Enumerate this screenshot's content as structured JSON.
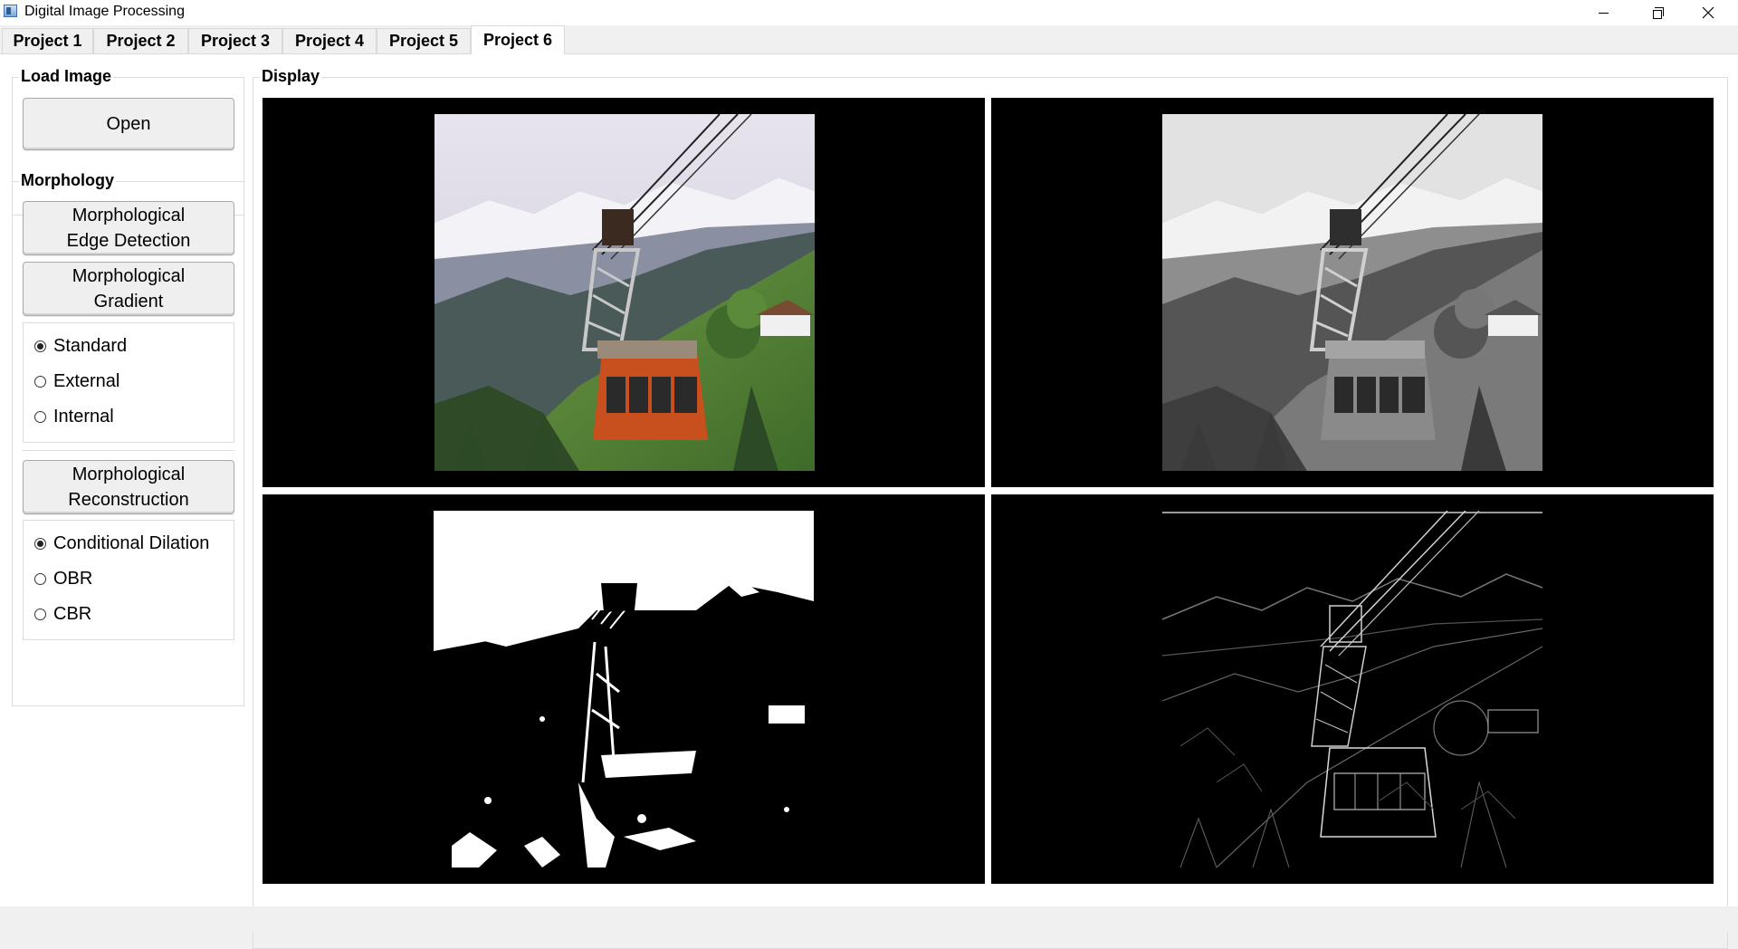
{
  "window": {
    "title": "Digital Image Processing"
  },
  "tabs": [
    {
      "label": "Project 1",
      "active": false
    },
    {
      "label": "Project 2",
      "active": false
    },
    {
      "label": "Project 3",
      "active": false
    },
    {
      "label": "Project 4",
      "active": false
    },
    {
      "label": "Project 5",
      "active": false
    },
    {
      "label": "Project 6",
      "active": true
    }
  ],
  "load_image": {
    "title": "Load Image",
    "open_label": "Open"
  },
  "morphology": {
    "title": "Morphology",
    "edge_detection": {
      "line1": "Morphological",
      "line2": "Edge Detection"
    },
    "gradient": {
      "line1": "Morphological",
      "line2": "Gradient"
    },
    "gradient_options": [
      {
        "label": "Standard",
        "checked": true
      },
      {
        "label": "External",
        "checked": false
      },
      {
        "label": "Internal",
        "checked": false
      }
    ],
    "reconstruction": {
      "line1": "Morphological",
      "line2": "Reconstruction"
    },
    "reconstruction_options": [
      {
        "label": "Conditional Dilation",
        "checked": true
      },
      {
        "label": "OBR",
        "checked": false
      },
      {
        "label": "CBR",
        "checked": false
      }
    ]
  },
  "display": {
    "title": "Display",
    "panes": [
      {
        "content": "original color photo — cable car over alpine valley"
      },
      {
        "content": "grayscale version"
      },
      {
        "content": "binary thresholded version"
      },
      {
        "content": "morphological edge result"
      }
    ]
  },
  "colors": {
    "window_bg": "#f0f0f0",
    "panel_bg": "#ffffff",
    "pane_bg": "#000000",
    "button_bg": "#efefef",
    "border": "#dcdcdc"
  }
}
